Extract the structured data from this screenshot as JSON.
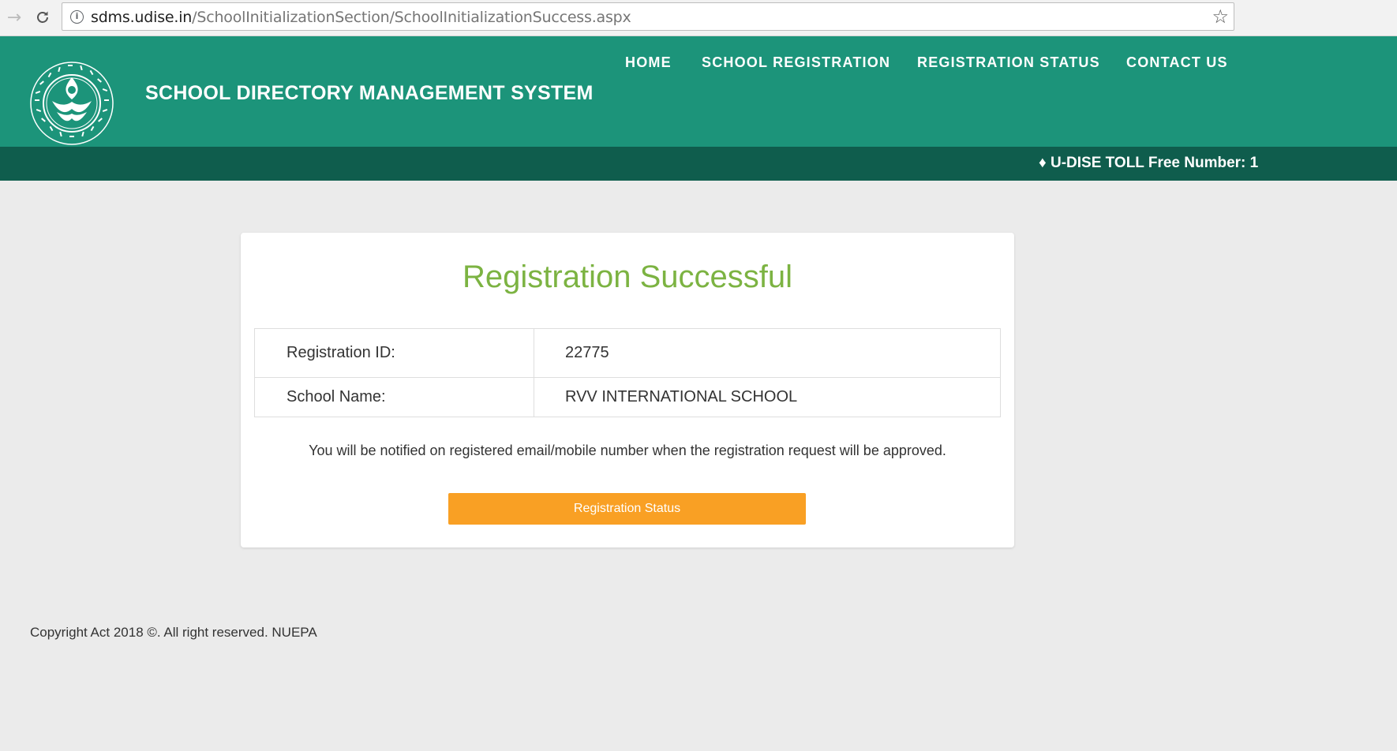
{
  "browser": {
    "url_host": "sdms.udise.in",
    "url_path": "/SchoolInitializationSection/SchoolInitializationSuccess.aspx"
  },
  "header": {
    "title": "SCHOOL DIRECTORY MANAGEMENT SYSTEM",
    "logo_text": "राष्ट्रीय शैक्षिक योजना एवं प्रशासन विश्वविद्यालय · NATIONAL UNIVERSITY OF EDUCATIONAL PLANNING AND ADMINISTRATION",
    "nav": [
      {
        "label": "HOME"
      },
      {
        "label": "SCHOOL REGISTRATION"
      },
      {
        "label": "REGISTRATION STATUS"
      },
      {
        "label": "CONTACT US"
      }
    ]
  },
  "ticker": {
    "text": "♦ U-DISE TOLL Free Number: 1"
  },
  "card": {
    "heading": "Registration Successful",
    "rows": [
      {
        "label": "Registration ID:",
        "value": "22775"
      },
      {
        "label": "School Name:",
        "value": "RVV INTERNATIONAL SCHOOL"
      }
    ],
    "notice": "You will be notified on registered email/mobile number when the registration request will be approved.",
    "button_label": "Registration Status"
  },
  "footer": {
    "text": "Copyright Act 2018 ©. All right reserved. NUEPA"
  },
  "colors": {
    "header_bg": "#1c947a",
    "ticker_bg": "#0f5d4d",
    "success_green": "#7cb342",
    "button_orange": "#f9a024"
  }
}
